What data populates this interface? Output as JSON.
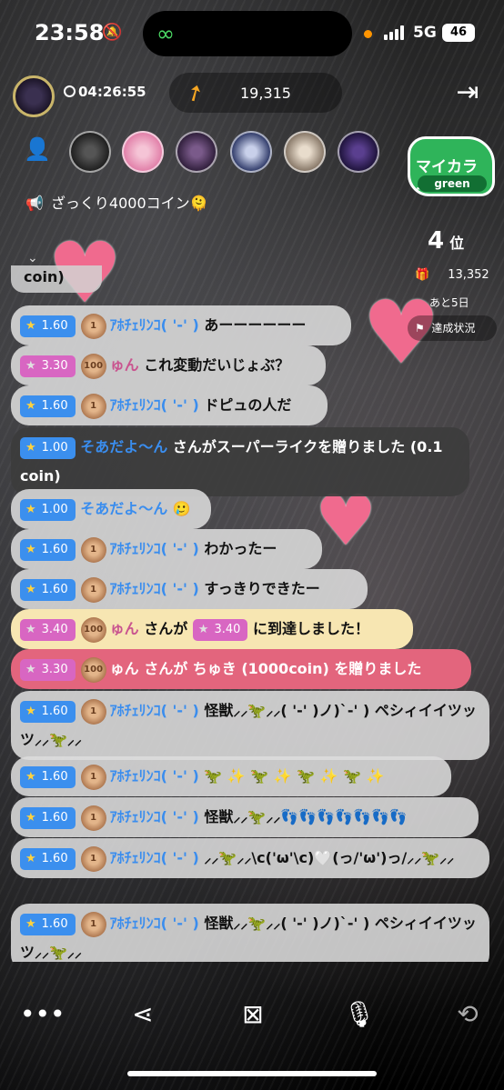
{
  "status_bar": {
    "time": "23:58",
    "network": "5G",
    "battery": "46"
  },
  "header": {
    "elapsed": "04:26:55",
    "score": "19,315"
  },
  "announcement": "ざっくり4000コイン🫠",
  "badge": {
    "line1": "マイカラー",
    "line2": "green"
  },
  "ranking": {
    "rank": "4",
    "rank_suffix": "位",
    "coins": "13,352",
    "remaining": "あと5日",
    "goal_label": "達成状況"
  },
  "chat": {
    "partial_top": "coin)",
    "messages": [
      {
        "level": "1.60",
        "medal": "1",
        "name": "ｱﾎﾁｪﾘﾝｺ( '-' )",
        "text": "あーーーーーー"
      },
      {
        "level": "3.30",
        "medal": "100",
        "name": "ゅん",
        "text": "これ変動だいじょぶ？"
      },
      {
        "level": "1.60",
        "medal": "1",
        "name": "ｱﾎﾁｪﾘﾝｺ( '-' )",
        "text": "ドピュの人だ"
      },
      {
        "level": "1.00",
        "name": "そあだよ〜ん",
        "text": "さんがスーパーライクを贈りました (0.1 coin)"
      },
      {
        "level": "1.00",
        "name": "そあだよ〜ん",
        "text": "🥲"
      },
      {
        "level": "1.60",
        "medal": "1",
        "name": "ｱﾎﾁｪﾘﾝｺ( '-' )",
        "text": "わかったー"
      },
      {
        "level": "1.60",
        "medal": "1",
        "name": "ｱﾎﾁｪﾘﾝｺ( '-' )",
        "text": "すっきりできたー"
      },
      {
        "level": "3.40",
        "medal": "100",
        "name": "ゅん",
        "text_a": "さんが",
        "level2": "3.40",
        "text_b": "に到達しました！"
      },
      {
        "level": "3.30",
        "medal": "100",
        "name": "ゅん",
        "text": "さんが ちゅき (1000coin) を贈りました"
      },
      {
        "level": "1.60",
        "medal": "1",
        "name": "ｱﾎﾁｪﾘﾝｺ( '-' )",
        "text": "怪獣⸝⸝🦖⸝⸝( '-' )ノ)`-' ) ペシィイイツッツ⸝⸝🦖⸝⸝"
      },
      {
        "level": "1.60",
        "medal": "1",
        "name": "ｱﾎﾁｪﾘﾝｺ( '-' )",
        "text": "🦖 ✨ 🦖 ✨ 🦖 ✨ 🦖 ✨"
      },
      {
        "level": "1.60",
        "medal": "1",
        "name": "ｱﾎﾁｪﾘﾝｺ( '-' )",
        "text": "怪獣⸝⸝🦖⸝⸝👣👣👣👣👣👣👣"
      },
      {
        "level": "1.60",
        "medal": "1",
        "name": "ｱﾎﾁｪﾘﾝｺ( '-' )",
        "text": "⸝⸝🦖⸝⸝\\c('ω'\\c)🤍(っ/'ω')っ/⸝⸝🦖⸝⸝"
      },
      {
        "level": "1.60",
        "medal": "1",
        "name": "ｱﾎﾁｪﾘﾝｺ( '-' )",
        "text": "怪獣⸝⸝🦖⸝⸝( '-' )ノ)`-' ) ペシィイイツッツ⸝⸝🦖⸝⸝"
      }
    ]
  },
  "icons": {
    "more": "more-icon",
    "share": "share-icon",
    "camera_off": "camera-off-icon",
    "mic": "mic-icon",
    "flip": "flip-camera-icon"
  },
  "colors": {
    "blue_level": "#3b8fee",
    "pink_level": "#d866c2",
    "name_blue": "#3a8dee",
    "name_pink": "#c9548f",
    "badge_green": "#2fb45a"
  }
}
